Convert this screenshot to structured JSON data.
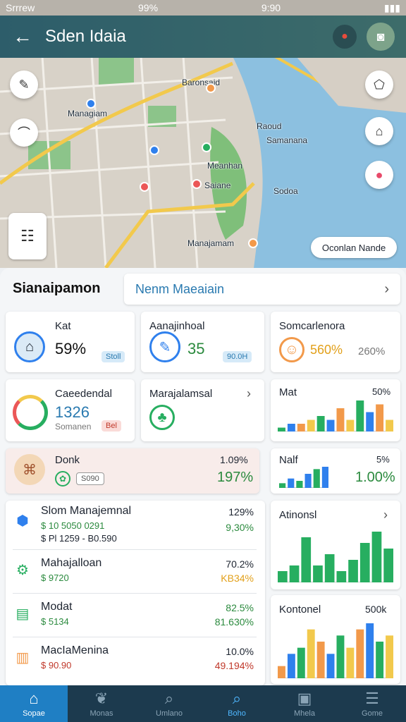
{
  "status": {
    "carrier": "Srrrew",
    "battery": "99%",
    "time": "9:90"
  },
  "appbar": {
    "title": "Sden Idaia"
  },
  "map": {
    "labels": [
      "Baronsaid",
      "Managiam",
      "Raoud",
      "Samanana",
      "Meanhan",
      "Saiane",
      "Sodoa",
      "Manajamam"
    ],
    "route_chip": "Oconlan Nande"
  },
  "sheet": {
    "title": "Sianaipamon",
    "search_value": "Nenm Maeaiain"
  },
  "cards": {
    "kat": {
      "label": "Kat",
      "value": "59%",
      "pill": "Stoll"
    },
    "anajinhoal": {
      "label": "Aanajinhoal",
      "value": "35",
      "pill": "90.0H"
    },
    "somcarleneora": {
      "label": "Somcarlenora",
      "value": "560%",
      "value2": "260%"
    },
    "caeedendal": {
      "label": "Caeedendal",
      "value": "1326",
      "sub": "Somanen",
      "pill": "Bel"
    },
    "marajalamsal": {
      "label": "Marajalamsal"
    },
    "mat": {
      "label": "Mat",
      "value": "50%",
      "chart": [
        1,
        2,
        2,
        3,
        4,
        3,
        6,
        3,
        8,
        5,
        7,
        3
      ]
    },
    "donk": {
      "label": "Donk",
      "value": "1.09%",
      "value2": "197%",
      "pill": "S090"
    },
    "nalf": {
      "label": "Nalf",
      "value": "5%",
      "value2": "1.00%",
      "chart": [
        2,
        4,
        3,
        6,
        8,
        9
      ]
    },
    "atinonsl": {
      "label": "Atinonsl",
      "chart": [
        2,
        3,
        8,
        3,
        5,
        2,
        4,
        7,
        9,
        6
      ]
    },
    "kontonel": {
      "label": "Kontonel",
      "value": "500k",
      "chart": [
        2,
        4,
        5,
        8,
        6,
        4,
        7,
        5,
        8,
        9,
        6,
        7
      ]
    }
  },
  "list": [
    {
      "name": "Slom Manajemnal",
      "sub1": "$ 10 5050 0291",
      "sub2": "$ Pl  1259 - B0.590",
      "v1": "129%",
      "v2": "9,30%"
    },
    {
      "name": "Mahajalloan",
      "sub1": "$ 9720",
      "v1": "70.2%",
      "v2": "KB34%"
    },
    {
      "name": "Modat",
      "sub1": "$ 5134",
      "v1": "82.5%",
      "v2": "81.630%"
    },
    {
      "name": "MacIaMenina",
      "sub1": "$ 90.90",
      "v1": "10.0%",
      "v2": "49.194%"
    }
  ],
  "tabs": [
    "Sopae",
    "Monas",
    "Umlano",
    "Boho",
    "Mhela",
    "Gome"
  ]
}
